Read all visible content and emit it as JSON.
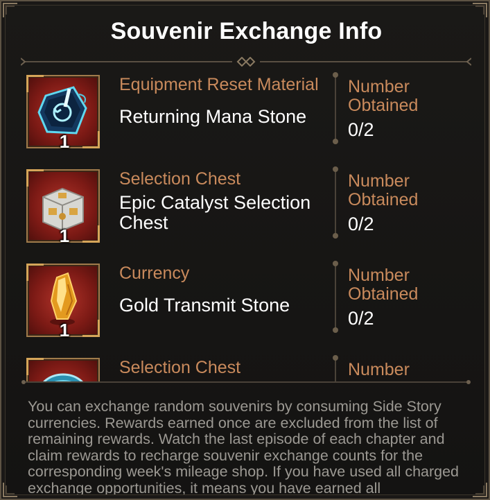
{
  "title": "Souvenir Exchange Info",
  "rewards": [
    {
      "category": "Equipment Reset Material",
      "name": "Returning Mana Stone",
      "quantity": "1",
      "obtained_label": "Number Obtained",
      "obtained_value": "0/2",
      "icon": "mana-stone-icon"
    },
    {
      "category": "Selection Chest",
      "name": "Epic Catalyst Selection Chest",
      "quantity": "1",
      "obtained_label": "Number Obtained",
      "obtained_value": "0/2",
      "icon": "chest-icon"
    },
    {
      "category": "Currency",
      "name": "Gold Transmit Stone",
      "quantity": "1",
      "obtained_label": "Number Obtained",
      "obtained_value": "0/2",
      "icon": "gold-crystal-icon"
    },
    {
      "category": "Selection Chest",
      "obtained_label": "Number",
      "icon": "orb-chest-icon"
    }
  ],
  "description": "You can exchange random souvenirs by consuming Side Story currencies. Rewards earned once are excluded from the list of remaining rewards. Watch the last episode of each chapter and claim rewards to recharge souvenir exchange counts for the corresponding week's mileage shop. If you have used all charged exchange opportunities, it means you have earned all",
  "colors": {
    "accent": "#c98a5c",
    "frame": "#a07b4b",
    "text": "#ffffff",
    "description": "#9c9993"
  }
}
